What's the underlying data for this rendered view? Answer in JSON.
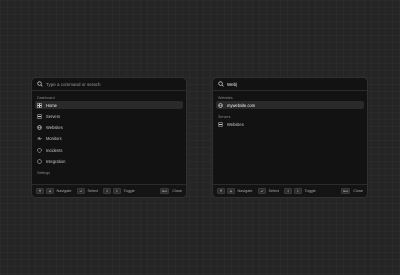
{
  "left_palette": {
    "search": {
      "placeholder": "Type a command or serach",
      "value": ""
    },
    "groups": [
      {
        "label": "Dashboard",
        "items": [
          {
            "label": "Home",
            "icon": "home-grid-icon",
            "active": true
          },
          {
            "label": "Servers",
            "icon": "server-icon",
            "active": false
          },
          {
            "label": "Websites",
            "icon": "globe-icon",
            "active": false
          },
          {
            "label": "Monitors",
            "icon": "activity-icon",
            "active": false
          },
          {
            "label": "Incidents",
            "icon": "shield-icon",
            "active": false
          },
          {
            "label": "Integration",
            "icon": "circle-icon",
            "active": false
          }
        ]
      },
      {
        "label": "Settings",
        "items": []
      }
    ]
  },
  "right_palette": {
    "search": {
      "placeholder": "",
      "value": "Web|"
    },
    "groups": [
      {
        "label": "Websites",
        "items": [
          {
            "label": "mywebsite.com",
            "icon": "globe-icon",
            "active": true
          }
        ]
      },
      {
        "label": "Servers",
        "items": [
          {
            "label": "Websites",
            "icon": "server-icon",
            "active": false
          }
        ]
      }
    ]
  },
  "footer": {
    "navigate_label": "Navigate",
    "select_label": "Select",
    "toggle_label": "Toggle",
    "close_label": "Close",
    "esc_key": "Esc"
  },
  "colors": {
    "background": "#252525",
    "panel": "#121212",
    "active_row": "#2a2a2a",
    "border": "#303030"
  }
}
